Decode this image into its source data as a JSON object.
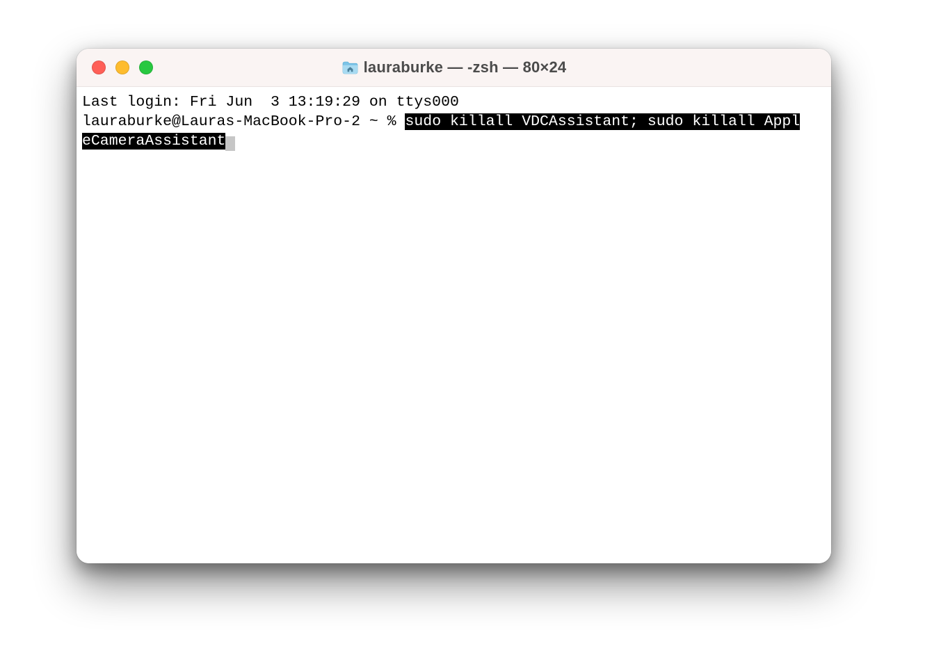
{
  "window": {
    "title": "lauraburke — -zsh — 80×24"
  },
  "terminal": {
    "last_login": "Last login: Fri Jun  3 13:19:29 on ttys000",
    "prompt": "lauraburke@Lauras-MacBook-Pro-2 ~ % ",
    "command_line1": "sudo killall VDCAssistant; sudo killall Appl",
    "command_line2": "eCameraAssistant"
  },
  "icons": {
    "folder": "home-folder-icon"
  },
  "colors": {
    "titlebar_bg": "#faf4f3",
    "selection_bg": "#000000",
    "selection_fg": "#ffffff",
    "traffic_red": "#ff5f57",
    "traffic_yellow": "#febc2e",
    "traffic_green": "#28c840"
  }
}
